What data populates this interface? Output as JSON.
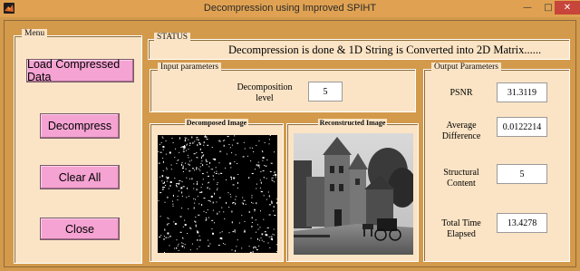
{
  "window": {
    "title": "Decompression using Improved SPIHT",
    "minimize_glyph": "—",
    "maximize_glyph": "□",
    "close_glyph": "✕"
  },
  "menu": {
    "title": "Menu",
    "buttons": {
      "load": "Load Compressed Data",
      "decompress": "Decompress",
      "clear": "Clear All",
      "close": "Close"
    }
  },
  "status": {
    "title": "STATUS",
    "text": "Decompression is done & 1D String is Converted into 2D Matrix......"
  },
  "input_params": {
    "title": "Input parameters",
    "decomposition_label": "Decomposition level",
    "decomposition_value": "5"
  },
  "images": {
    "decomposed_title": "Decomposed Image",
    "reconstructed_title": "Reconstructed Image"
  },
  "output_params": {
    "title": "Output Parameters",
    "psnr_label": "PSNR",
    "psnr_value": "31.3119",
    "avg_diff_label": "Average Difference",
    "avg_diff_value": "0.0122214",
    "structural_label": "Structural Content",
    "structural_value": "5",
    "time_label": "Total Time Elapsed",
    "time_value": "13.4278"
  },
  "colors": {
    "background": "#d39a4c",
    "panel": "#fbe4c5",
    "button": "#f5a3d2",
    "close_button": "#c7453a"
  }
}
